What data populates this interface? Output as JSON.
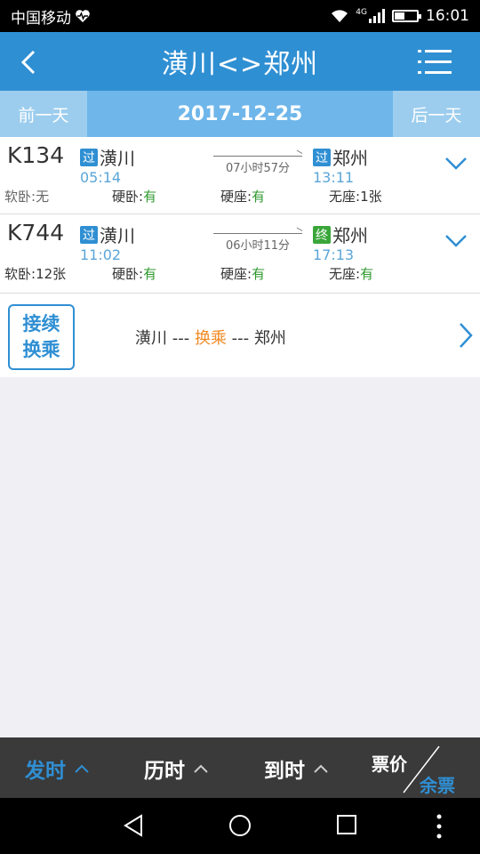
{
  "status": {
    "carrier": "中国移动",
    "network": "4G",
    "time": "16:01",
    "battery_percent": 45
  },
  "header": {
    "title": "潢川<>郑州",
    "back_icon": "chevron-left-icon",
    "menu_icon": "list-menu-icon"
  },
  "datebar": {
    "prev_label": "前一天",
    "date": "2017-12-25",
    "next_label": "后一天"
  },
  "trains": [
    {
      "number": "K134",
      "from_badge": "过",
      "from": "潢川",
      "depart": "05:14",
      "duration": "07小时57分",
      "to_badge": "过",
      "to": "郑州",
      "arrive": "13:11",
      "seats": [
        {
          "label": "软卧:",
          "value": "无"
        },
        {
          "label": "硬卧:",
          "value": "有"
        },
        {
          "label": "硬座:",
          "value": "有"
        },
        {
          "label": "无座:",
          "value": "1张"
        }
      ]
    },
    {
      "number": "K744",
      "from_badge": "过",
      "from": "潢川",
      "depart": "11:02",
      "duration": "06小时11分",
      "to_badge": "终",
      "to": "郑州",
      "arrive": "17:13",
      "seats": [
        {
          "label": "软卧:",
          "value": "12张"
        },
        {
          "label": "硬卧:",
          "value": "有"
        },
        {
          "label": "硬座:",
          "value": "有"
        },
        {
          "label": "无座:",
          "value": "有"
        }
      ]
    }
  ],
  "transfer": {
    "button_line1": "接续",
    "button_line2": "换乘",
    "from": "潢川",
    "sep": " --- ",
    "mid": "换乘",
    "to": "郑州"
  },
  "sortbar": {
    "depart": "发时",
    "duration": "历时",
    "arrive": "到时",
    "price": "票价",
    "remain": "余票"
  },
  "colors": {
    "primary": "#2f8fd3",
    "available": "#2f9a2f",
    "accent_orange": "#f08a24"
  }
}
